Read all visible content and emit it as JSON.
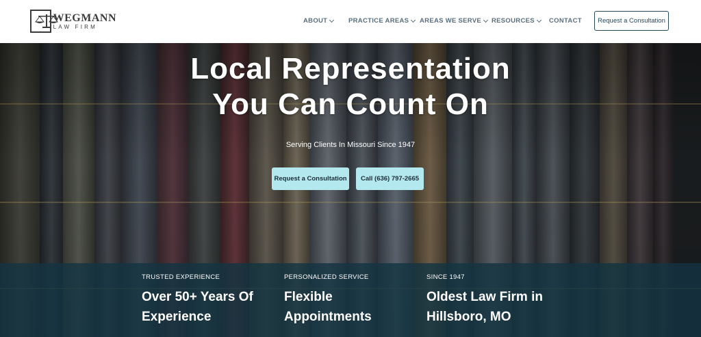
{
  "brand": {
    "name": "WEGMANN",
    "sub": "LAW FIRM",
    "icon": "scales-of-justice-icon"
  },
  "nav": {
    "items": [
      {
        "label": "ABOUT",
        "has_dropdown": true
      },
      {
        "label": "PRACTICE AREAS",
        "has_dropdown": true
      },
      {
        "label": "AREAS WE SERVE",
        "has_dropdown": true
      },
      {
        "label": "RESOURCES",
        "has_dropdown": true
      },
      {
        "label": "CONTACT",
        "has_dropdown": false
      }
    ],
    "cta_label": "Request a Consultation"
  },
  "hero": {
    "title_line1": "Local Representation",
    "title_line2": "You Can Count On",
    "subtitle": "Serving Clients In Missouri Since 1947",
    "primary_button": "Request a Consultation",
    "secondary_button": "Call (636) 797-2665"
  },
  "features": [
    {
      "label": "TRUSTED EXPERIENCE",
      "heading_line1": "Over 50+ Years Of",
      "heading_line2": "Experience"
    },
    {
      "label": "PERSONALIZED SERVICE",
      "heading_line1": "Flexible",
      "heading_line2": "Appointments"
    },
    {
      "label": "SINCE 1947",
      "heading_line1": "Oldest Law Firm in",
      "heading_line2": "Hillsboro, MO"
    }
  ],
  "colors": {
    "nav_text": "#586e7d",
    "cta_border": "#23485a",
    "hero_button_bg": "#b4e8ef",
    "band_bg": "#143442"
  }
}
